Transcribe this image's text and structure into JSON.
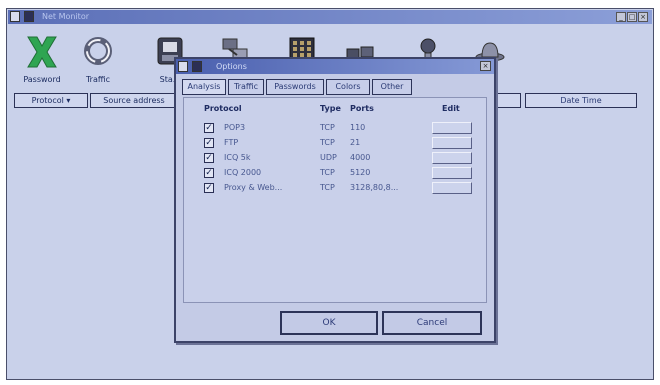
{
  "window": {
    "title": "Net Monitor"
  },
  "toolbar": {
    "items": [
      {
        "label": "Password",
        "icon": "x-icon"
      },
      {
        "label": "Traffic",
        "icon": "ring-icon"
      },
      {
        "label": "Sta...",
        "icon": "disk-icon"
      },
      {
        "label": "",
        "icon": "network-icon"
      },
      {
        "label": "",
        "icon": "grid-icon"
      },
      {
        "label": "",
        "icon": "computers-icon"
      },
      {
        "label": "",
        "icon": "bulb-icon"
      },
      {
        "label": "",
        "icon": "hat-icon"
      }
    ]
  },
  "columns": {
    "protocol": "Protocol",
    "source": "Source address",
    "date_time": "Date Time"
  },
  "dialog": {
    "title": "Options",
    "tabs": [
      "Analysis",
      "Traffic",
      "Passwords",
      "Colors",
      "Other"
    ],
    "headers": {
      "protocol": "Protocol",
      "type": "Type",
      "ports": "Ports",
      "edit": "Edit"
    },
    "rows": [
      {
        "checked": true,
        "protocol": "POP3",
        "type": "TCP",
        "ports": "110"
      },
      {
        "checked": true,
        "protocol": "FTP",
        "type": "TCP",
        "ports": "21"
      },
      {
        "checked": true,
        "protocol": "ICQ 5k",
        "type": "UDP",
        "ports": "4000"
      },
      {
        "checked": true,
        "protocol": "ICQ 2000",
        "type": "TCP",
        "ports": "5120"
      },
      {
        "checked": true,
        "protocol": "Proxy & Web...",
        "type": "TCP",
        "ports": "3128,80,8..."
      }
    ],
    "ok_label": "OK",
    "cancel_label": "Cancel"
  },
  "colors": {
    "background": "#c9d1ea",
    "titlebar": "#5b6fb7",
    "accent_green": "#2fa552"
  }
}
